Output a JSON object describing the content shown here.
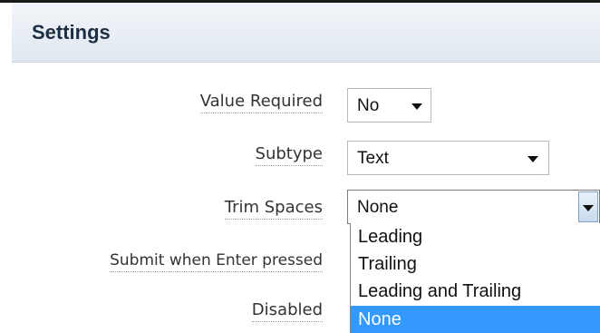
{
  "panel": {
    "title": "Settings"
  },
  "fields": {
    "value_required": {
      "label": "Value Required",
      "value": "No"
    },
    "subtype": {
      "label": "Subtype",
      "value": "Text"
    },
    "trim_spaces": {
      "label": "Trim Spaces",
      "value": "None",
      "options": [
        "Leading",
        "Trailing",
        "Leading and Trailing",
        "None"
      ],
      "highlighted_option": "None"
    },
    "submit_when_enter": {
      "label": "Submit when Enter pressed"
    },
    "disabled": {
      "label": "Disabled"
    }
  },
  "colors": {
    "header_bg_top": "#f3f6fa",
    "header_bg_bottom": "#dfe7ef",
    "title_text": "#1f2f43",
    "selection_bg": "#3399ff",
    "selection_text": "#ffffff"
  }
}
